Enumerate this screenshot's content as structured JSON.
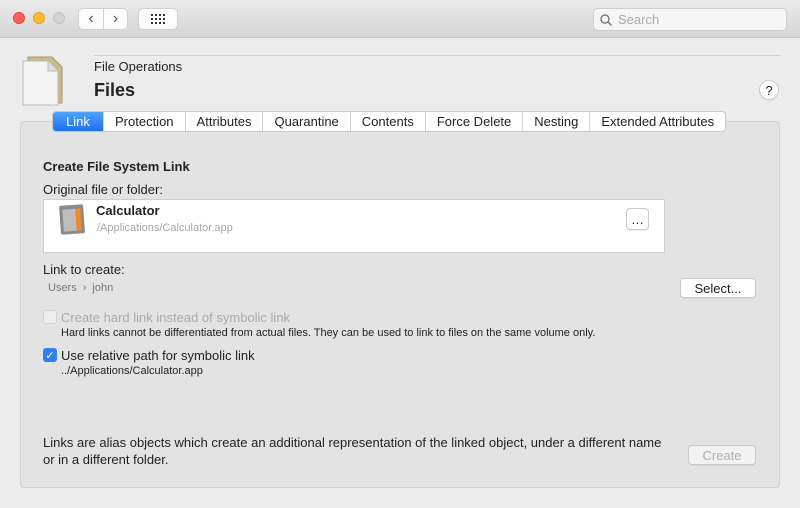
{
  "toolbar": {
    "back_icon": "chevron-left-icon",
    "forward_icon": "chevron-right-icon",
    "grid_icon": "grid-icon",
    "search_placeholder": "Search"
  },
  "header": {
    "subtitle": "File Operations",
    "title": "Files",
    "help": "?"
  },
  "tabs": [
    {
      "label": "Link",
      "active": true
    },
    {
      "label": "Protection"
    },
    {
      "label": "Attributes"
    },
    {
      "label": "Quarantine"
    },
    {
      "label": "Contents"
    },
    {
      "label": "Force Delete"
    },
    {
      "label": "Nesting"
    },
    {
      "label": "Extended Attributes"
    }
  ],
  "link": {
    "section_title": "Create File System Link",
    "original_label": "Original file or folder:",
    "file_name": "Calculator",
    "file_path": "/Applications/Calculator.app",
    "more_button": "…",
    "link_label": "Link to create:",
    "path": [
      "Users",
      "john"
    ],
    "path_sep": "›",
    "select_button": "Select...",
    "hard_link": {
      "label": "Create hard link instead of symbolic link",
      "checked": false,
      "enabled": false,
      "description": "Hard links cannot be differentiated from actual files. They can be used to link to files on the same volume only."
    },
    "relative": {
      "label": "Use relative path for symbolic link",
      "checked": true,
      "value": "../Applications/Calculator.app"
    },
    "footer_text": "Links are alias objects which create an additional representation of the linked object, under a different name or in a different folder.",
    "create_button": "Create"
  },
  "colors": {
    "accent": "#2f80f5"
  }
}
